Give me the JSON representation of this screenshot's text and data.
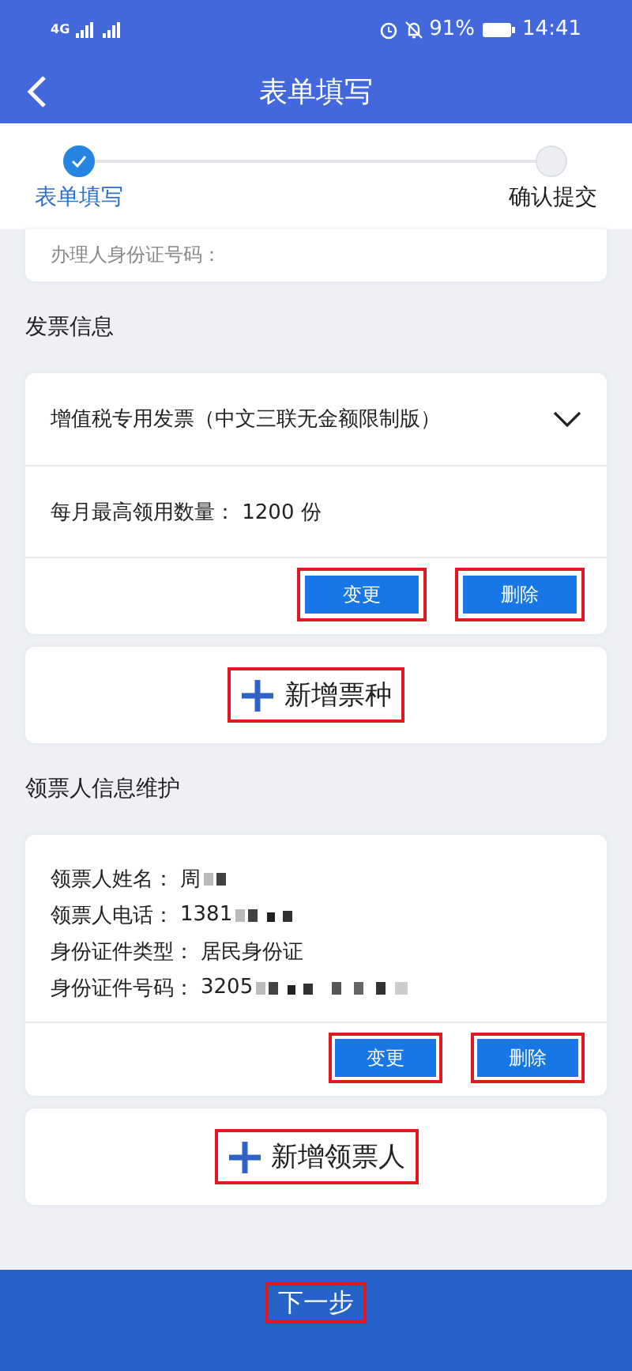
{
  "status_bar": {
    "network": "4G",
    "battery": "91%",
    "time": "14:41"
  },
  "header": {
    "title": "表单填写"
  },
  "steps": [
    {
      "label": "表单填写",
      "done": true
    },
    {
      "label": "确认提交",
      "done": false
    }
  ],
  "prev_card": {
    "text": "办理人身份证号码："
  },
  "invoice_section": {
    "title": "发票信息",
    "invoices": [
      {
        "type": "增值税专用发票（中文三联无金额限制版）",
        "quota": "每月最高领用数量： 1200 份",
        "buttons": [
          {
            "label": "变更",
            "highlighted": true
          },
          {
            "label": "删除",
            "highlighted": true
          }
        ]
      }
    ],
    "add_button": {
      "label": "新增票种",
      "highlighted": true
    }
  },
  "collector_section": {
    "title": "领票人信息维护",
    "collectors": [
      {
        "fields": [
          {
            "label": "领票人姓名：",
            "value": "周",
            "kind": "masked"
          },
          {
            "label": "领票人电话：",
            "value": "1381",
            "kind": "masked"
          },
          {
            "label": "身份证件类型：",
            "value": "居民身份证",
            "kind": "plain"
          },
          {
            "label": "身份证件号码：",
            "value": "3205",
            "kind": "masked"
          }
        ],
        "buttons": [
          {
            "label": "变更",
            "highlighted": true
          },
          {
            "label": "删除",
            "highlighted": true
          }
        ]
      }
    ],
    "add_button": {
      "label": "新增领票人",
      "highlighted": true
    }
  },
  "footer": {
    "label": "下一步",
    "highlighted": true
  }
}
